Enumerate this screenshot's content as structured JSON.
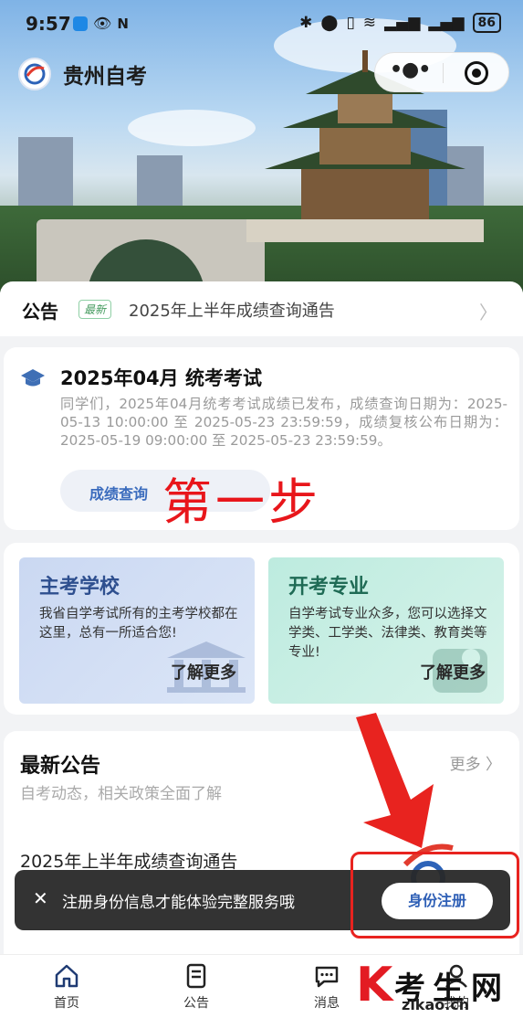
{
  "status_bar": {
    "time": "9:57",
    "battery": "86"
  },
  "header": {
    "app_title": "贵州自考",
    "more_icon": "more-dots-icon",
    "close_icon": "target-circle-icon"
  },
  "notice": {
    "tag": "公告",
    "badge": "最新",
    "text": "2025年上半年成绩查询通告"
  },
  "exam_card": {
    "title": "2025年04月 统考考试",
    "description": "同学们，2025年04月统考考试成绩已发布，成绩查询日期为：2025-05-13 10:00:00 至 2025-05-23 23:59:59，成绩复核公布日期为：2025-05-19 09:00:00 至 2025-05-23 23:59:59。",
    "button_label": "成绩查询",
    "annotation": "第一步"
  },
  "features": [
    {
      "title": "主考学校",
      "description": "我省自学考试所有的主考学校都在这里，总有一所适合您!",
      "more": "了解更多"
    },
    {
      "title": "开考专业",
      "description": "自学考试专业众多，您可以选择文学类、工学类、法律类、教育类等专业!",
      "more": "了解更多"
    }
  ],
  "latest": {
    "title": "最新公告",
    "subtitle": "自考动态，相关政策全面了解",
    "more": "更多 〉",
    "items": [
      "2025年上半年成绩查询通告"
    ]
  },
  "toast": {
    "message": "注册身份信息才能体验完整服务哦",
    "button": "身份注册",
    "close": "✕"
  },
  "tabbar": [
    {
      "label": "首页",
      "icon": "home-icon"
    },
    {
      "label": "公告",
      "icon": "document-icon"
    },
    {
      "label": "消息",
      "icon": "chat-icon"
    },
    {
      "label": "我的",
      "icon": "user-icon"
    }
  ],
  "watermark": {
    "brand": "考生网",
    "url": "zikao.cn"
  },
  "colors": {
    "accent": "#3a6bbd",
    "annotation_red": "#e8161b"
  }
}
